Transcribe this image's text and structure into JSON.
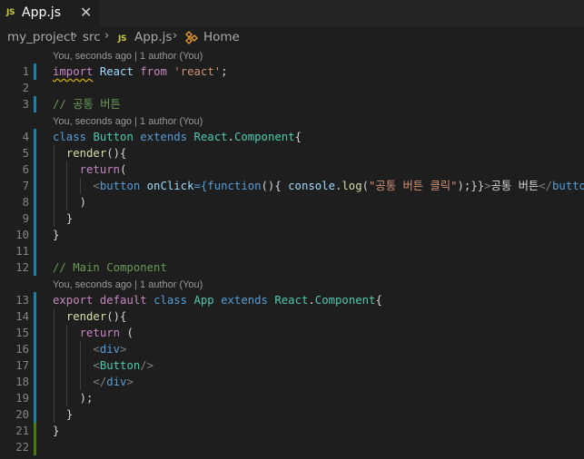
{
  "tab": {
    "icon": "JS",
    "label": "App.js",
    "close": "✕"
  },
  "breadcrumb": {
    "items": [
      "my_project",
      "src",
      "App.js",
      "Home"
    ],
    "separator": "›",
    "file_icon": "JS"
  },
  "codelens": {
    "line1": "You, seconds ago | 1 author (You)",
    "line3": "You, seconds ago | 1 author (You)",
    "line12": "You, seconds ago | 1 author (You)"
  },
  "line_numbers": [
    "1",
    "2",
    "3",
    "4",
    "5",
    "6",
    "7",
    "8",
    "9",
    "10",
    "11",
    "12",
    "13",
    "14",
    "15",
    "16",
    "17",
    "18",
    "19",
    "20",
    "21",
    "22"
  ],
  "code": {
    "l1": {
      "import": "import",
      "react_var": "React",
      "from": "from",
      "str": "'react'",
      "semi": ";"
    },
    "l3": "// 공통 버튼",
    "l4": {
      "class": "class",
      "name": "Button",
      "extends": "extends",
      "base": "React",
      "dot": ".",
      "comp": "Component",
      "brace": "{"
    },
    "l5": {
      "fn": "render",
      "rest": "(){"
    },
    "l6": {
      "ret": "return",
      "paren": "("
    },
    "l7": {
      "lt1": "<",
      "tag1": "button",
      "attr": "onClick",
      "eq": "={",
      "func": "function",
      "p1": "(){ ",
      "console": "console",
      "dot": ".",
      "log": "log",
      "p2": "(",
      "str": "\"공통 버튼 클릭\"",
      "p3": ");}}",
      "gt": ">",
      "text": "공통 버튼",
      "lt2": "</",
      "tag2": "button",
      "gt2": ">"
    },
    "l8": ")",
    "l9": "}",
    "l10": "}",
    "l12": "// Main Component",
    "l13": {
      "export": "export",
      "default": "default",
      "class": "class",
      "name": "App",
      "extends": "extends",
      "base": "React",
      "dot": ".",
      "comp": "Component",
      "brace": "{"
    },
    "l14": {
      "fn": "render",
      "rest": "(){"
    },
    "l15": {
      "ret": "return",
      "paren": " ("
    },
    "l16": {
      "lt": "<",
      "tag": "div",
      "gt": ">"
    },
    "l17": {
      "lt": "<",
      "tag": "Button",
      "gt": "/>"
    },
    "l18": {
      "lt": "</",
      "tag": "div",
      "gt": ">"
    },
    "l19": ");",
    "l20": "}",
    "l21": "}"
  },
  "colors": {
    "git_modified": "#1b81a8",
    "git_added": "#487e02",
    "js_icon": "#cbcb41"
  }
}
